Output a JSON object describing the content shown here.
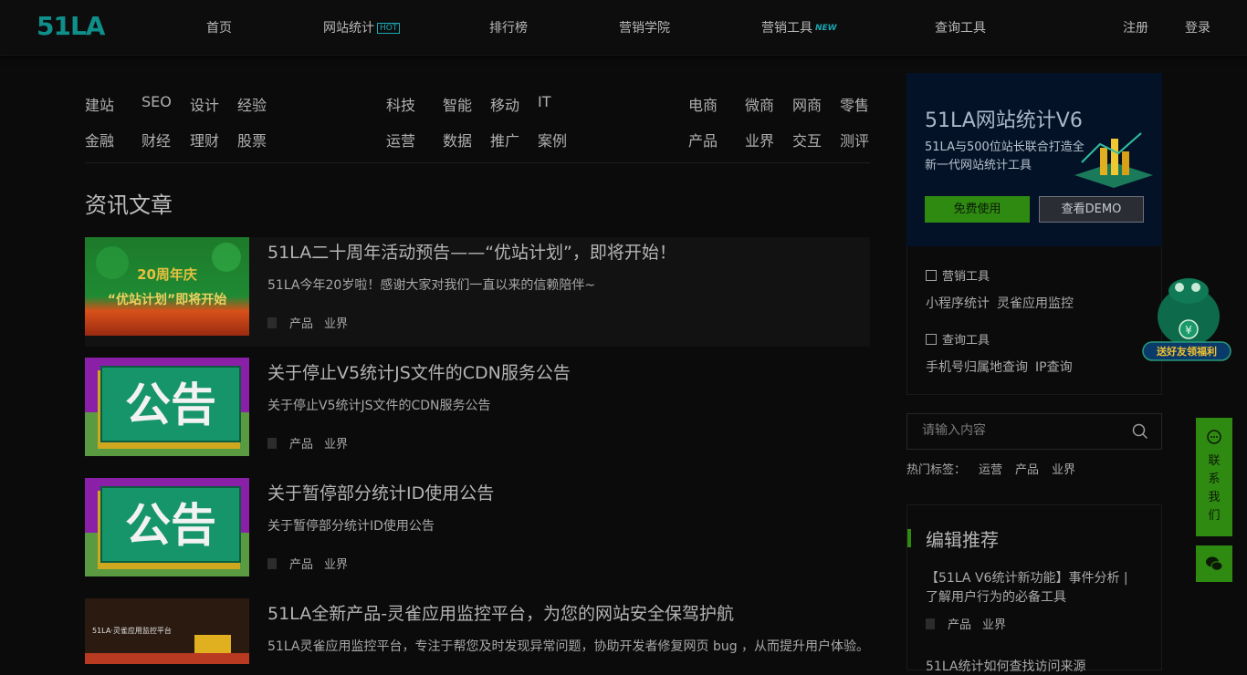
{
  "header": {
    "logo": "51LA",
    "nav": [
      {
        "label": "首页"
      },
      {
        "label": "网站统计",
        "tag": "HOT"
      },
      {
        "label": "排行榜"
      },
      {
        "label": "营销学院"
      },
      {
        "label": "营销工具",
        "tag": "NEW"
      },
      {
        "label": "查询工具"
      }
    ],
    "register": "注册",
    "login": "登录"
  },
  "categories": {
    "group1": [
      [
        "建站",
        "SEO",
        "设计",
        "经验"
      ],
      [
        "金融",
        "财经",
        "理财",
        "股票"
      ]
    ],
    "group2": [
      [
        "科技",
        "智能",
        "移动",
        "IT"
      ],
      [
        "运营",
        "数据",
        "推广",
        "案例"
      ]
    ],
    "group3": [
      [
        "电商",
        "微商",
        "网商",
        "零售"
      ],
      [
        "产品",
        "业界",
        "交互",
        "测评"
      ]
    ]
  },
  "section_title": "资讯文章",
  "articles": [
    {
      "title": "51LA二十周年活动预告——“优站计划”，即将开始！",
      "desc": "51LA今年20岁啦！感谢大家对我们一直以来的信赖陪伴~",
      "tags": [
        "产品",
        "业界"
      ],
      "thumb_text1": "20周年庆",
      "thumb_text2": "“优站计划”即将开始"
    },
    {
      "title": "关于停止V5统计JS文件的CDN服务公告",
      "desc": "关于停止V5统计JS文件的CDN服务公告",
      "tags": [
        "产品",
        "业界"
      ],
      "thumb_text": "公告"
    },
    {
      "title": "关于暂停部分统计ID使用公告",
      "desc": "关于暂停部分统计ID使用公告",
      "tags": [
        "产品",
        "业界"
      ],
      "thumb_text": "公告"
    },
    {
      "title": "51LA全新产品-灵雀应用监控平台，为您的网站安全保驾护航",
      "desc": "51LA灵雀应用监控平台，专注于帮您及时发现异常问题，协助开发者修复网页 bug ，从而提升用户体验。",
      "thumb_text": "51LA·灵雀应用监控平台"
    }
  ],
  "promo": {
    "title": "51LA网站统计V6",
    "subtitle": "51LA与500位站长联合打造全新一代网站统计工具",
    "btn_free": "免费使用",
    "btn_demo": "查看DEMO"
  },
  "tools": {
    "marketing_head": "营销工具",
    "marketing_links": [
      "小程序统计",
      "灵雀应用监控"
    ],
    "query_head": "查询工具",
    "query_links": [
      "手机号归属地查询",
      "IP查询"
    ]
  },
  "search": {
    "placeholder": "请输入内容"
  },
  "hot_tags": {
    "label": "热门标签：",
    "items": [
      "运营",
      "产品",
      "业界"
    ]
  },
  "editor": {
    "title": "编辑推荐",
    "item_title": "【51LA V6统计新功能】事件分析 | 了解用户行为的必备工具",
    "item_tags": [
      "产品",
      "业界"
    ],
    "next_item": "51LA统计如何查找访问来源"
  },
  "float": {
    "contact": "联系我们",
    "mascot_text": "送好友领福利"
  },
  "colors": {
    "accent": "#2f8a12",
    "logo": "#0f8f8a",
    "promo_bg": "#031227"
  }
}
